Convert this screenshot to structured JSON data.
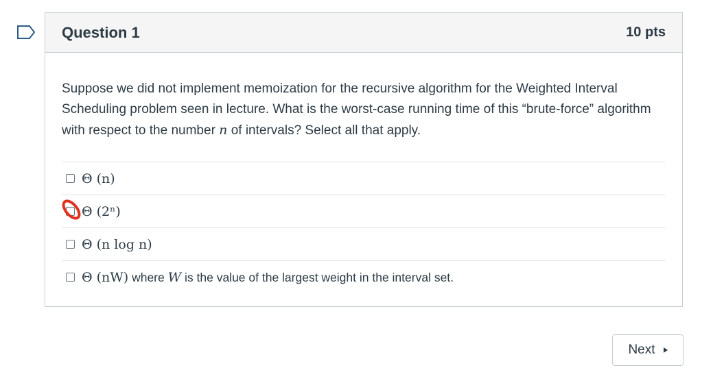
{
  "question": {
    "title": "Question 1",
    "points": "10 pts",
    "text_part1": "Suppose we did not implement memoization for the recursive algorithm for the Weighted Interval Scheduling problem seen in lecture. What is the worst-case running time of this “brute-force” algorithm with respect to the number ",
    "text_var": "n",
    "text_part2": " of intervals? Select all that apply."
  },
  "answers": [
    {
      "math": "Θ (n)",
      "suffix": "",
      "checked": false
    },
    {
      "math": "Θ (2ⁿ)",
      "suffix": "",
      "checked": false
    },
    {
      "math": "Θ (n log n)",
      "suffix": "",
      "checked": false
    },
    {
      "math": "Θ (nW)",
      "suffix_part1": " where ",
      "suffix_var": "W",
      "suffix_part2": " is the value of the largest weight in the interval set.",
      "checked": false
    }
  ],
  "navigation": {
    "next_label": "Next"
  },
  "colors": {
    "text": "#2d3b45",
    "header_bg": "#f5f5f5",
    "border": "#c7cdd1",
    "annotation_red": "#e0301e"
  },
  "icons": {
    "flag": "flag-outline-icon",
    "next": "caret-right-icon",
    "annotation": "red-circle-annotation"
  }
}
